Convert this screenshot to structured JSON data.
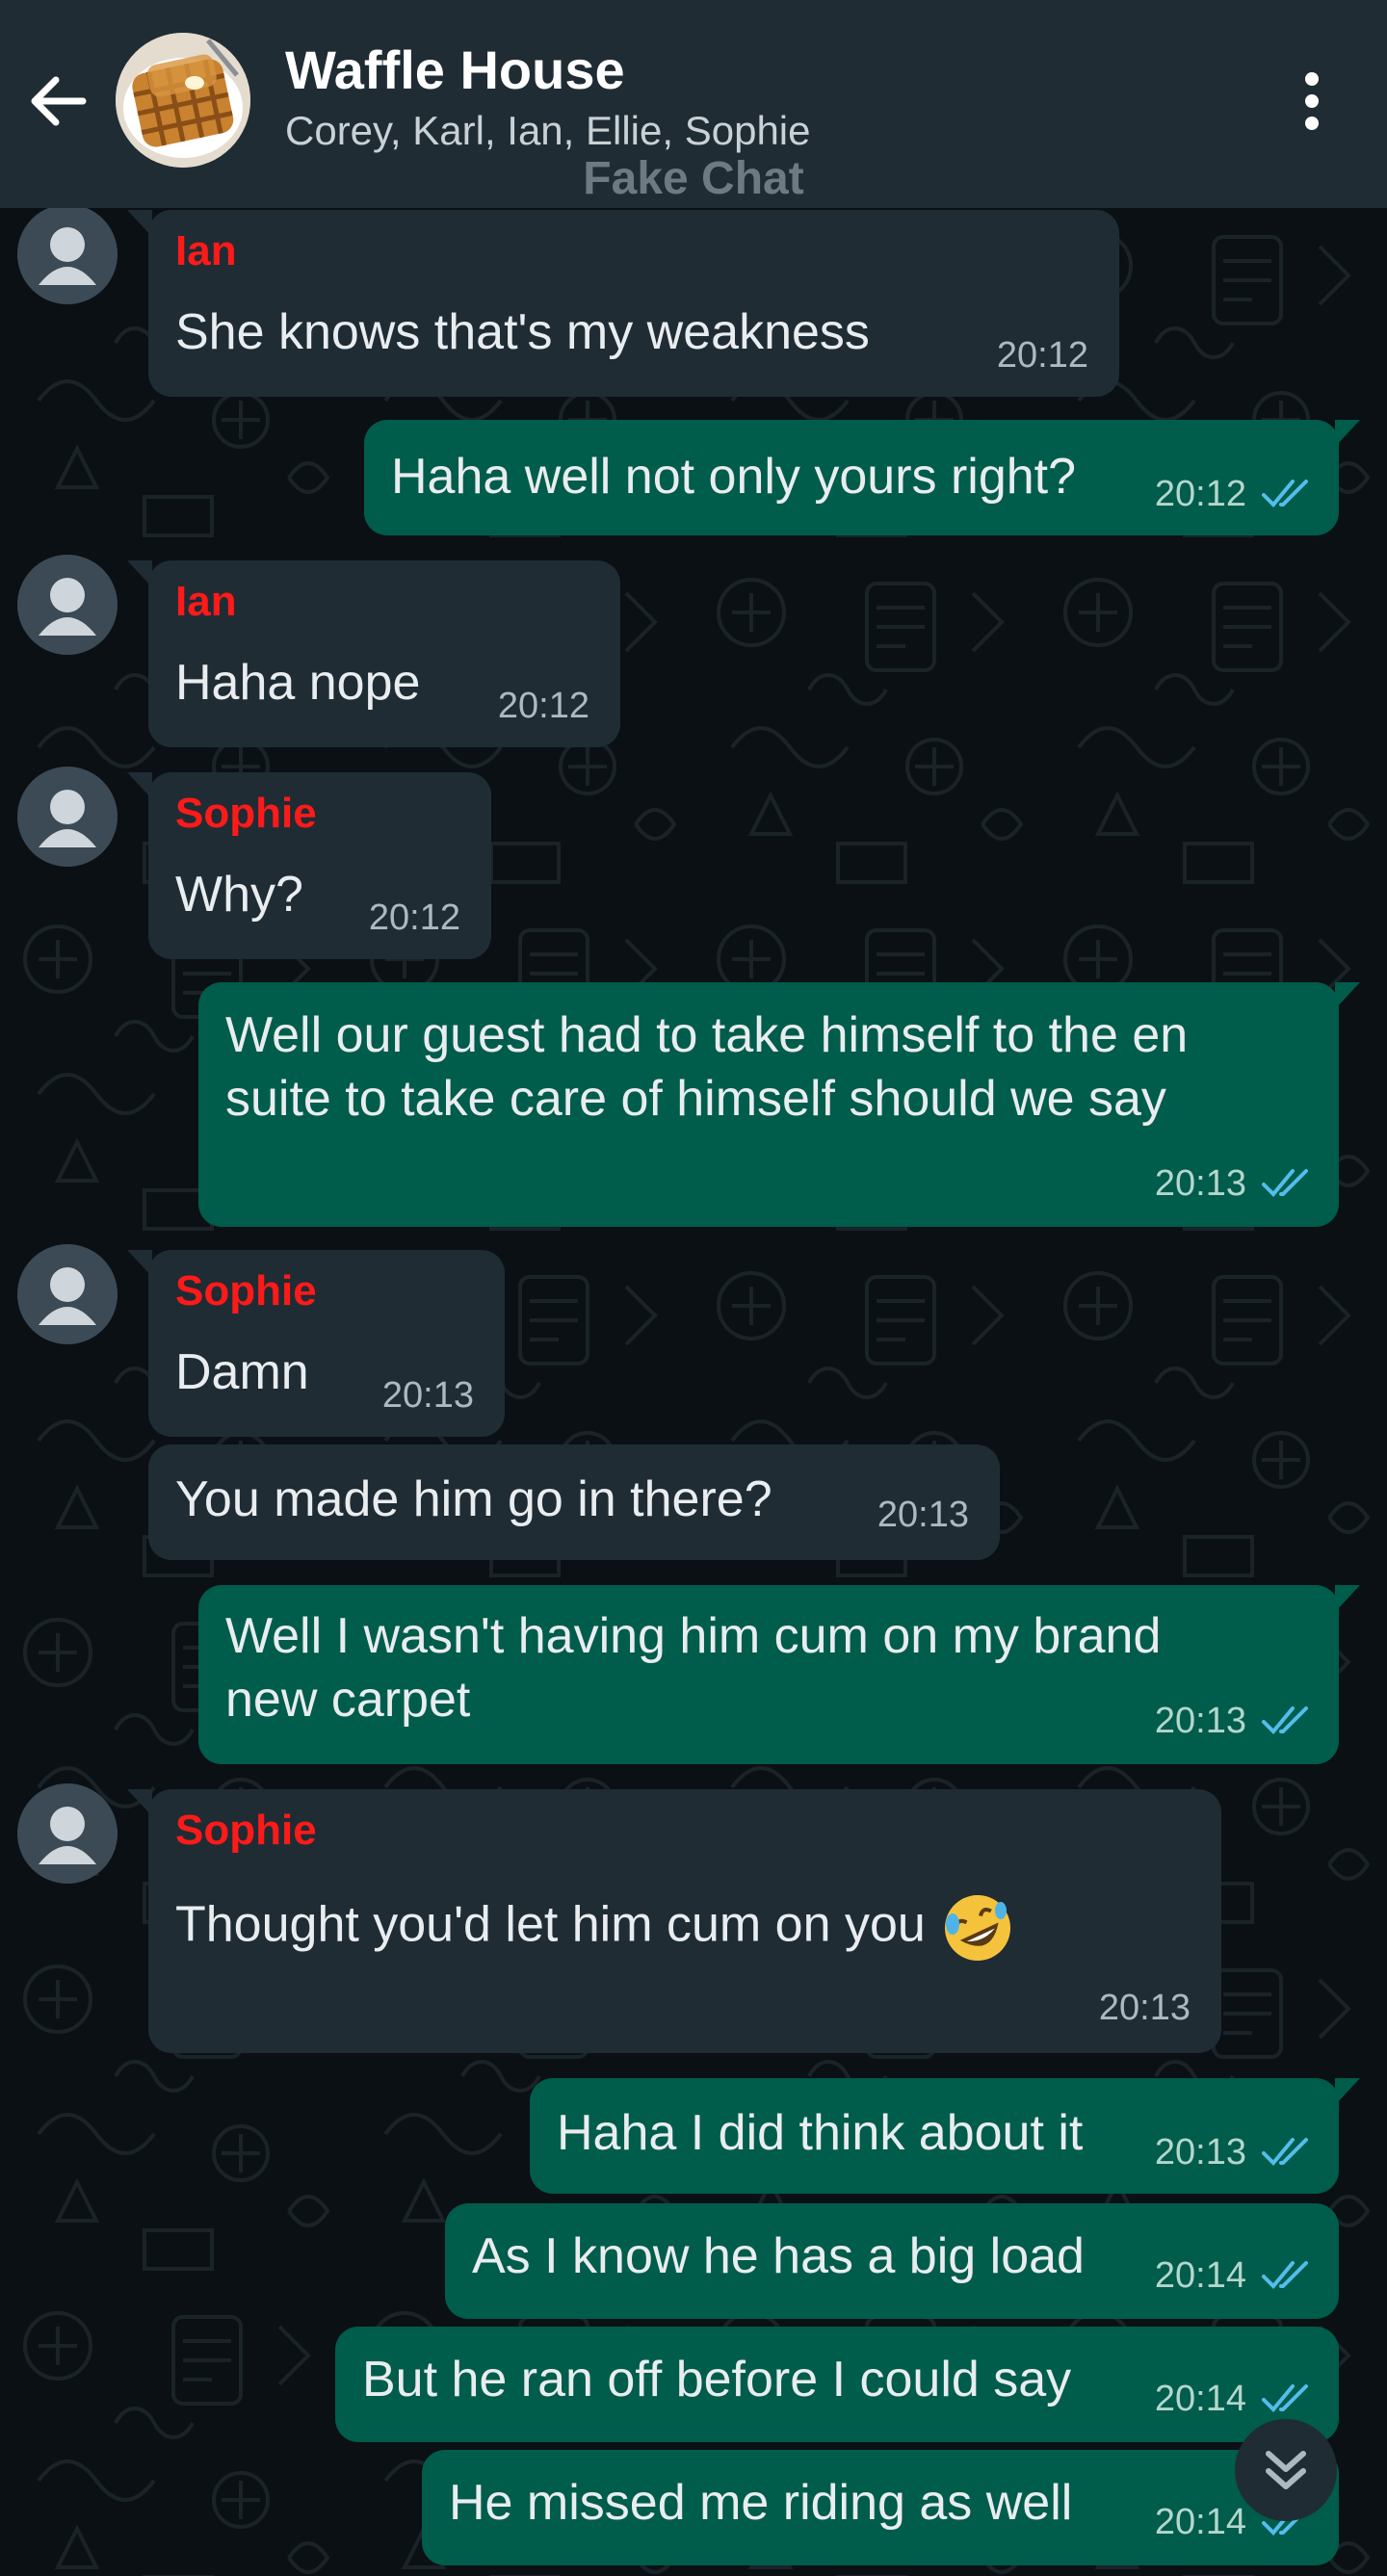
{
  "header": {
    "title": "Waffle House",
    "participants": "Corey, Karl, Ian, Ellie, Sophie",
    "watermark": "Fake Chat"
  },
  "messages": [
    {
      "dir": "in",
      "sender": "Ian",
      "text": "She knows that's my weakness",
      "time": "20:12"
    },
    {
      "dir": "out",
      "text": "Haha well not only yours right?",
      "time": "20:12",
      "status": "read"
    },
    {
      "dir": "in",
      "sender": "Ian",
      "text": "Haha nope",
      "time": "20:12"
    },
    {
      "dir": "in",
      "sender": "Sophie",
      "text": "Why?",
      "time": "20:12"
    },
    {
      "dir": "out",
      "text_line1": "Well our guest had to take himself to the en",
      "text_line2": "suite to take care of himself should we say",
      "time": "20:13",
      "status": "read"
    },
    {
      "dir": "in",
      "sender": "Sophie",
      "text": "Damn",
      "time": "20:13"
    },
    {
      "dir": "in",
      "text": "You made him go in there?",
      "time": "20:13"
    },
    {
      "dir": "out",
      "text_line1": "Well I wasn't having him cum on my brand",
      "text_line2": "new carpet",
      "time": "20:13",
      "status": "read"
    },
    {
      "dir": "in",
      "sender": "Sophie",
      "text": "Thought you'd let him cum on you",
      "emoji": "rolling-on-floor-laughing",
      "time": "20:13"
    },
    {
      "dir": "out",
      "text": "Haha I did think about it",
      "time": "20:13",
      "status": "read"
    },
    {
      "dir": "out",
      "text": "As I know he has a big load",
      "time": "20:14",
      "status": "read"
    },
    {
      "dir": "out",
      "text": "But he ran off before I could say",
      "time": "20:14",
      "status": "read"
    },
    {
      "dir": "out",
      "text": "He missed me riding as well",
      "time": "20:14",
      "status": "read"
    }
  ],
  "icons": {
    "back": "arrow-left-icon",
    "menu": "more-vertical-icon",
    "scroll": "double-chevron-down-icon",
    "read_ticks": "double-check-icon"
  },
  "colors": {
    "header_bg": "#1f2c34",
    "chat_bg": "#0b1014",
    "incoming_bubble": "#1f2c34",
    "outgoing_bubble": "#005c4b",
    "sender_name": "#ff1a1a",
    "read_ticks": "#53bdeb"
  }
}
